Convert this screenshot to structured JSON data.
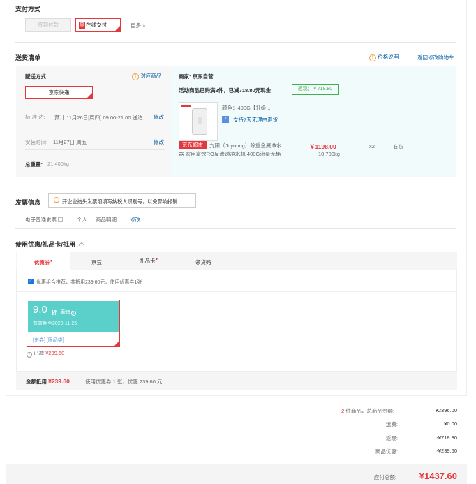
{
  "payment": {
    "title": "支付方式",
    "cod": "货到付款",
    "online_badge": "惠",
    "online": "在线支付",
    "more": "更多",
    "more_arrow": "»"
  },
  "delivery": {
    "title": "送货清单",
    "price_note": "价格说明",
    "back_cart": "返回修改购物车",
    "method_label": "配送方式",
    "corr_goods": "对应商品",
    "method": "京东快递",
    "std_label": "标 准 达:",
    "std_value": "预计 11月26日[周四] 09:00-21:00 送达",
    "std_edit": "修改",
    "install_label": "安装时间:",
    "install_value": "11月27日 周五",
    "install_edit": "修改",
    "weight_label": "总重量:",
    "weight_value": "21.400kg",
    "merchant_label": "商家:",
    "merchant": "京东自营",
    "promo": "活动商品已购满2件，已减718.80元现金",
    "rebate": "返现：￥718.80",
    "item": {
      "tag": "京东超市",
      "name_l1": "九阳（Joyoung）除重金属净水",
      "name_l2": "器 家用富饮RO反渗透净水机 400G流量无桶",
      "color": "颜色：400G【升级...",
      "return7": "支持7天无理由退货",
      "price": "￥1198.00",
      "weight": "10.700kg",
      "qty": "x2",
      "stock": "有货"
    }
  },
  "invoice": {
    "title": "发票信息",
    "tip": "开企业抬头发票须填写纳税人识别号，以免影响报销",
    "type": "电子普通发票",
    "person": "个人",
    "detail": "商品明细",
    "edit": "修改"
  },
  "coupons": {
    "title": "使用优惠/礼品卡/抵用",
    "tabs": [
      {
        "label": "优惠券"
      },
      {
        "label": "京豆"
      },
      {
        "label": "礼品卡"
      },
      {
        "label": "领货码"
      }
    ],
    "recommend": "优惠组合推荐，共抵用239.60元，使用优惠券1张",
    "card": {
      "value": "9.0",
      "unit": "折",
      "cond": "满99",
      "expire": "有效期至2020-11-25",
      "tags": "[东券] [限品类]"
    },
    "reduced_label": "已减",
    "reduced_value": "¥239.60",
    "summary_label": "金额抵用",
    "summary_value": "¥239.60",
    "summary_note": "使用优惠券 1 张，优惠 239.60 元"
  },
  "totals": {
    "count": "2",
    "count_text": "件商品，总商品金额:",
    "goods_amount": "¥2396.00",
    "freight_label": "运费:",
    "freight": "¥0.00",
    "rebate_label": "返现:",
    "rebate": "-¥718.80",
    "discount_label": "商品优惠:",
    "discount": "-¥239.60",
    "payable_label": "应付总额:",
    "payable": "¥1437.60"
  },
  "colors": {
    "accent": "#e4393c",
    "link": "#005ea7",
    "teal": "#5bcfc9"
  }
}
